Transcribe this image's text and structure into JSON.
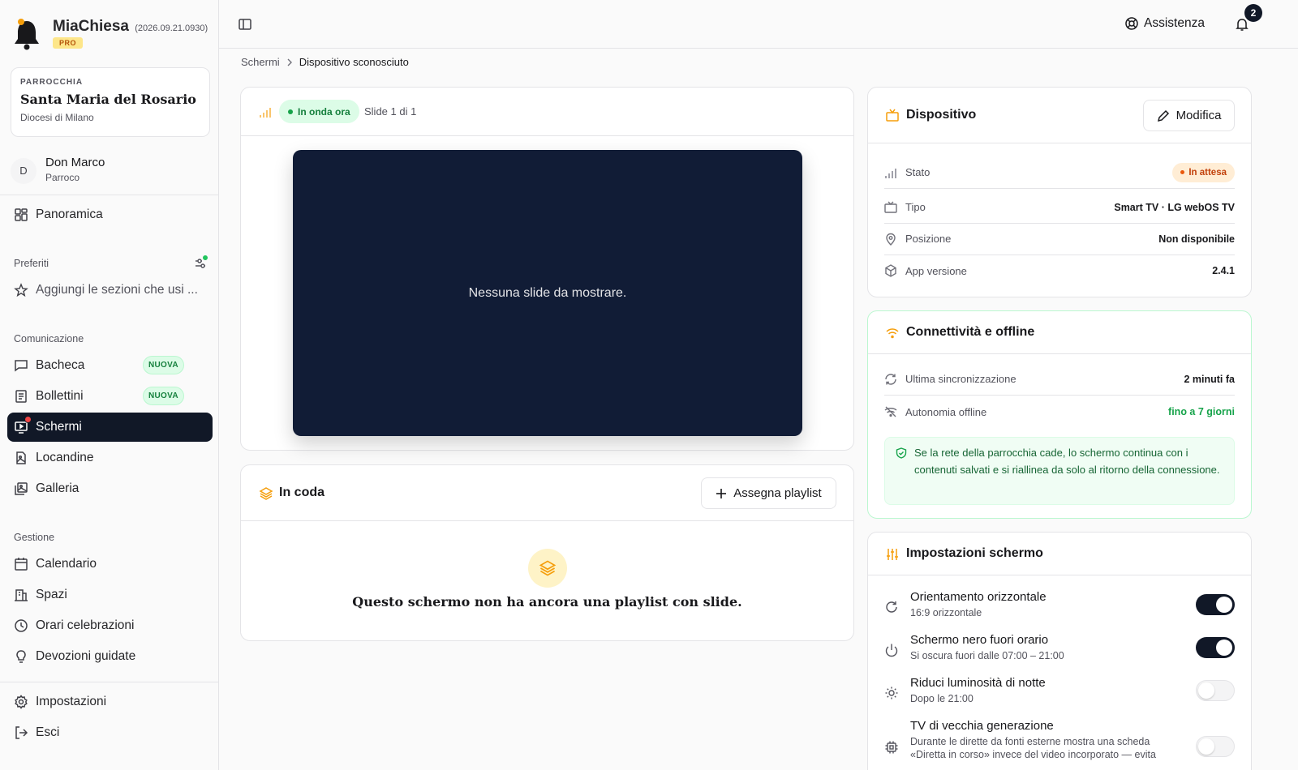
{
  "app": {
    "name": "MiaChiesa",
    "version": "(2026.09.21.0930)",
    "plan": "PRO"
  },
  "parish": {
    "label": "PARROCCHIA",
    "name": "Santa Maria del Rosario",
    "diocese": "Diocesi di Milano"
  },
  "user": {
    "initial": "D",
    "name": "Don Marco",
    "role": "Parroco"
  },
  "sidebar": {
    "overview": "Panoramica",
    "favorites": {
      "title": "Preferiti",
      "placeholder": "Aggiungi le sezioni che usi ..."
    },
    "communication": {
      "title": "Comunicazione",
      "items": [
        {
          "label": "Bacheca",
          "badge": "NUOVA"
        },
        {
          "label": "Bollettini",
          "badge": "NUOVA"
        },
        {
          "label": "Schermi"
        },
        {
          "label": "Locandine"
        },
        {
          "label": "Galleria"
        }
      ]
    },
    "management": {
      "title": "Gestione",
      "items": [
        {
          "label": "Calendario"
        },
        {
          "label": "Spazi"
        },
        {
          "label": "Orari celebrazioni"
        },
        {
          "label": "Devozioni guidate"
        }
      ]
    },
    "settings": "Impostazioni",
    "logout": "Esci"
  },
  "header": {
    "help": "Assistenza",
    "notifications_count": "2"
  },
  "breadcrumb": [
    "Schermi",
    "Dispositivo sconosciuto"
  ],
  "preview": {
    "live_badge": "In onda ora",
    "slide_counter": "Slide 1 di 1",
    "empty": "Nessuna slide da mostrare."
  },
  "queue": {
    "title": "In coda",
    "assign_button": "Assegna playlist",
    "empty": "Questo schermo non ha ancora una playlist con slide."
  },
  "device": {
    "title": "Dispositivo",
    "edit_button": "Modifica",
    "rows": [
      {
        "label": "Stato",
        "value": "In attesa"
      },
      {
        "label": "Tipo",
        "value": "Smart TV · LG webOS TV"
      },
      {
        "label": "Posizione",
        "value": "Non disponibile"
      },
      {
        "label": "App versione",
        "value": "2.4.1"
      }
    ]
  },
  "connectivity": {
    "title": "Connettività e offline",
    "rows": [
      {
        "label": "Ultima sincronizzazione",
        "value": "2 minuti fa"
      },
      {
        "label": "Autonomia offline",
        "value": "fino a 7 giorni"
      }
    ],
    "note": "Se la rete della parrocchia cade, lo schermo continua con i contenuti salvati e si riallinea da solo al ritorno della connessione."
  },
  "screen_settings": {
    "title": "Impostazioni schermo",
    "items": [
      {
        "title": "Orientamento orizzontale",
        "desc": "16:9 orizzontale",
        "on": true
      },
      {
        "title": "Schermo nero fuori orario",
        "desc": "Si oscura fuori dalle 07:00 – 21:00",
        "on": true
      },
      {
        "title": "Riduci luminosità di notte",
        "desc": "Dopo le 21:00",
        "on": false
      },
      {
        "title": "TV di vecchia generazione",
        "desc": "Durante le dirette da fonti esterne mostra una scheda «Diretta in corso» invece del video incorporato — evita",
        "on": false
      }
    ]
  },
  "colors": {
    "accent_dark": "#111827",
    "live_green": "#16a34a",
    "warning": "#c2410c",
    "amber_icon": "#f59e0b"
  }
}
